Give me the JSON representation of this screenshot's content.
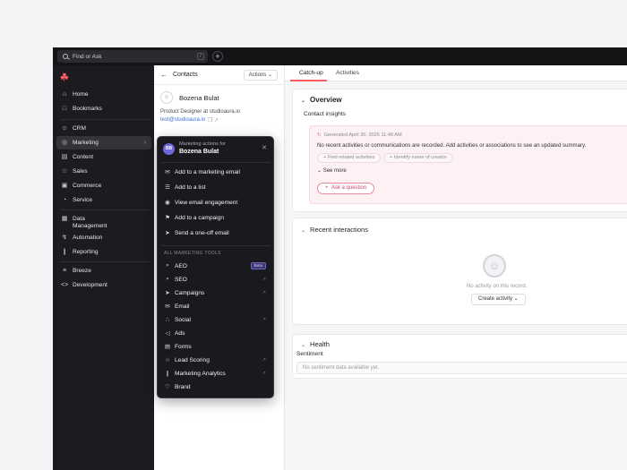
{
  "topbar": {
    "search_placeholder": "Find or Ask",
    "shortcut": "/",
    "plus": "+"
  },
  "sidebar": {
    "items": [
      {
        "label": "Home",
        "icon": "home-icon"
      },
      {
        "label": "Bookmarks",
        "icon": "bookmark-icon"
      },
      {
        "label": "CRM",
        "icon": "users-icon"
      },
      {
        "label": "Marketing",
        "icon": "marketing-icon"
      },
      {
        "label": "Content",
        "icon": "document-icon"
      },
      {
        "label": "Sales",
        "icon": "star-icon"
      },
      {
        "label": "Commerce",
        "icon": "cart-icon"
      },
      {
        "label": "Service",
        "icon": "service-icon"
      },
      {
        "label": "Data Management",
        "icon": "database-icon"
      },
      {
        "label": "Automation",
        "icon": "bolt-icon"
      },
      {
        "label": "Reporting",
        "icon": "chart-icon"
      },
      {
        "label": "Breeze",
        "icon": "breeze-icon"
      },
      {
        "label": "Development",
        "icon": "code-icon"
      }
    ]
  },
  "contact": {
    "header": "Contacts",
    "actions": "Actions",
    "name": "Bozena Bulat",
    "title": "Product Designer at studioaura.io",
    "email": "test@studioaura.io"
  },
  "main": {
    "tabs": [
      "Catch-up",
      "Activities"
    ],
    "overview": {
      "title": "Overview",
      "insights_label": "Contact insights",
      "generated": "Generated April 30, 2026 11:48 AM",
      "message": "No recent activities or communications are recorded. Add activities or associations to see an updated summary.",
      "chips": [
        "Find related activities",
        "Identify name of creator"
      ],
      "see_more": "See more",
      "ask": "Ask a question"
    },
    "recent": {
      "title": "Recent interactions",
      "empty": "No activity on this record.",
      "create": "Create activity"
    },
    "health": {
      "title": "Health",
      "sentiment_label": "Sentiment",
      "sentiment_empty": "No sentiment data available yet."
    }
  },
  "popup": {
    "subtitle": "Marketing actions for",
    "initials": "BB",
    "name": "Bozena Bulat",
    "actions": [
      {
        "label": "Add to a marketing email",
        "icon": "mail-icon"
      },
      {
        "label": "Add to a list",
        "icon": "list-icon"
      },
      {
        "label": "View email engagement",
        "icon": "eye-icon"
      },
      {
        "label": "Add to a campaign",
        "icon": "flag-icon"
      },
      {
        "label": "Send a one-off email",
        "icon": "send-icon"
      }
    ],
    "section_title": "ALL MARKETING TOOLS",
    "tools": [
      {
        "label": "AEO",
        "icon": "search-icon",
        "badge": "Beta"
      },
      {
        "label": "SEO",
        "icon": "search-icon"
      },
      {
        "label": "Campaigns",
        "icon": "send-icon"
      },
      {
        "label": "Email",
        "icon": "mail-icon"
      },
      {
        "label": "Social",
        "icon": "share-icon"
      },
      {
        "label": "Ads",
        "icon": "megaphone-icon"
      },
      {
        "label": "Forms",
        "icon": "form-icon"
      },
      {
        "label": "Lead Scoring",
        "icon": "star-icon"
      },
      {
        "label": "Marketing Analytics",
        "icon": "chart-icon"
      },
      {
        "label": "Brand",
        "icon": "heart-icon"
      }
    ]
  },
  "colors": {
    "accent": "#ff5a5f",
    "popup_bg": "#1a1a1e",
    "sidebar_bg": "#1c1c20",
    "beta_badge": "#3b3970"
  }
}
